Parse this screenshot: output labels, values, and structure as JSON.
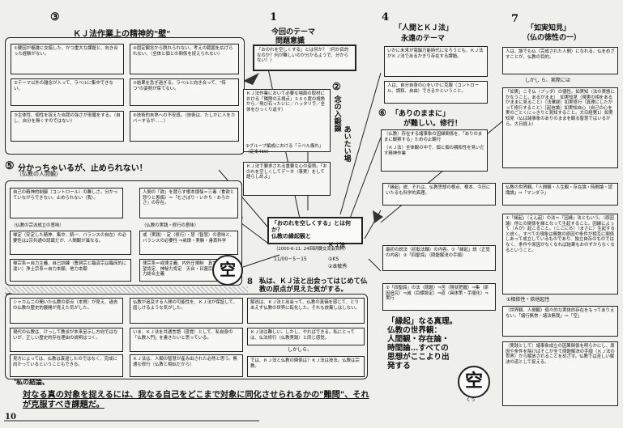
{
  "s3": {
    "num": "③",
    "title": "ＫＪ法作業上の精神的\"壁\"",
    "items": [
      "①要因が複雑に交錯した、かつ重大な課題と、向き合った経験がない。",
      "④固定観念から脱れられない。考えの範囲を広げられない。（全体と個との関係を捉えられない）",
      "②テーマ以外の雑念が入って、ラベルに集中できない。",
      "⑤結果を急ぎ過ぎる。ラベルと向き合って、\"待つ\"の姿勢が保てない。",
      "③主体性、個性を捉えた自我の強さが邪魔をする。（自し、自分を無くすのではない）",
      "⑥技術的未熟への不安感。（技術は、たしかに人をカバーするが……）"
    ]
  },
  "s5": {
    "num": "⑤",
    "title": "分かっちゃいるが、止められない！",
    "sub": "（仏教の人間観）",
    "left": "自己の精神的制御（コントロール）の難しさ。分かっていながらできない。止められない（我）。",
    "right": "人間の「欲」を競らす根本煩悩＝三毒（食欲と怒りと愚痴）＝「むさぼり・いかり・おろかさ」の存在。",
    "l_lbl": "（仏教の宗派成立の意味）",
    "r_lbl": "（仏教の実践・修行の意味）",
    "mid_l": "禅定（安定した精神、集中、統一、バランスの自在）の必要性は2宗共通の認識だが、人間観が異なる。",
    "mid_r": "戒（実践）・定（修行）・慧（智慧）の意味と、バランスの必要性 ⇒戒律・実験・書斎科学",
    "bot_l": "禅宗系＝自力主義、自己訓練（曹洞宗と臨済宗は臨床的に違い）浄土宗系＝自力本願、他力本願",
    "bot_r": "律宗系＝戒律主義、内外圧規制　真言宗系＝欲望肯定、神秘力肯定　天台・日蓮宗系＝自力他力総合主義"
  },
  "s1": {
    "num": "1",
    "title": "今回のテーマ",
    "sub": "問題意識",
    "q": "「おのれを空しくする」とは何か？（何か目的なのか？何が難しいのか分かるようで、分からない！）",
    "a": "ＫＪ法作業において必要な場面の取材における「隣際の五視点」３６０度の視角から／飛び石ったいに／ハッタリで／全体をひっくり返す）",
    "c": "②グループ編成における「ラベル振れ」（定本450）",
    "d": "ＫＪ法で要求される重要な心の姿勢。「おのれを空しくしてデータ（事実）をして語らしめよ」"
  },
  "s2": {
    "num": "②",
    "title": "念の入鍛錬",
    "sub": "あいたい場"
  },
  "s4": {
    "num": "4",
    "title": "「人間とＫＪ法」",
    "sub": "永遠のテーマ",
    "a": "いかに未来が電脳万能時代になろうとも、ＫＪ法がＫＪ法であるかぎり存在する課題。",
    "b": "人は、自分自身の心をいかに克服（コントロール、調和、自由）できるかということ。"
  },
  "s6": {
    "num": "⑥",
    "title": "「ありのままに」",
    "sub": "が難しい。修行！",
    "a": "（仏教）存在する諸事象の因縁関係を、「ありのままに観察する」ための止観行",
    "b": "（ＫＪ法）全体観の中で、個と個の親和性を見いだす精神作業"
  },
  "s7": {
    "num": "7",
    "title": "「如実知見」",
    "sub": "（仏の徳性の一）",
    "a": "人は、誰でも仏（完成された人間）になれる。仏をめざすことが、仏教の目的。",
    "but": "しかし ら、実際には",
    "b": "「如実」こそ仏（ブッダ）の徳性。如実知（法の実態にかなうこと。あるがまま）　如実知見（現実の相をあるがままに見ること）［法華経］如実修行（真理にしたがって修行すること）［起信論］如実知自心（自己の心を実のごとくにっきりと見知すること。大日経第1）如実知見（仏は諸事象のありのままを観る智慧ではいるから。大日経上）"
  },
  "center": {
    "title": "「おのれを空しくする」とは何か？",
    "sub": "仏教の縁起観と",
    "sub2": "ＫＪ法",
    "small": "（2000-6-11. 24回研鑽交流会資料）",
    "date": "11/00－5－15",
    "who": "②KS",
    "who2": "②本敏秀",
    "mark": "空"
  },
  "s8": {
    "num": "8",
    "text": "私は、ＫＪ法と出会ってはじめて仏教の原点が見えた気がする。"
  },
  "s9": {
    "num": "⑨",
    "a": "シャカムニの開いた仏教の原点（本質）が見え、過去の仏教の歴史的展開が見えた気がした。",
    "b": "仏教が追及する人間の可能性を、ＫＪ法が保証して、屈しけるような気がした。",
    "c": "解说は、ＫＪ法と出会って、仏教の真価を感じて、とりあえず仏教の世界に転化した。それも放棄しはしない。",
    "d": "現代の仏教は、けっして教派が本来呈示し方向ではないが、正しい歴史的存在理由の説明はつく。",
    "e": "いま、ＫＪ法を共通言語（感覚）として、私自身の「仏教入門」を書きたいと思っている。",
    "f": "ＫＪ法は難しい。しかし、やればできる。私にとっては、仏法修行（仏教実践）と同じ感覚。",
    "g": "見方によっては、仏教は衰退したのではなく、完成に向かっているということもできる。",
    "h": "ＫＪ法は、人類の智慧が産み出された必然と思う。無通な修行（仏教と相似だから）",
    "i": "ＫＪ法は、仏教と相似。すすめの場をもちたい。ＫＪ法は、仏教の。それこそ",
    "j": "では、ＫＪ法と仏教の関係は？ＫＪ法は技法。仏教は宗教。",
    "but": "しかしら、"
  },
  "right": {
    "a": "「縁起」説、それは、仏教思想の根点、根本、今日にいたるも科学的真理。",
    "b": "仏教の世界観。「人間観・人生観・存在論・時間論・認識論」⇒「マンダラ」",
    "c": "最初の説法（初転法輪）の内容。①「縁起」説（正覚の内容）②「四聖諦」（問題解決の手順）",
    "d": "①「縁起」（えん起）の法＝「因縁」法ともいう。（原因論）他との関係を縁となって生起すること。因縁によって（Ａが）起こること。（ここにＢ）（まさに）生起すると説く。すべての現象は無数の原因や条件が相互に関係しあって成立しているものであり、独立自存のものではなく、条件や原因がなくなれば結果もおのずからなくなるということ。",
    "e": "②「四聖諦」の法〈問題〉⇒苦（現状把握）⇒集（原因追究）⇒滅（目標設定）⇒道（具体策・手順化）⇒実行",
    "f": "①相依性・依他起性",
    "g": "（世界観、人間観）個々的な実体的存在をもってありえない。「諸行無常・諸法無我」＝「空」",
    "h": "〔実践として〕諸事象成立の因果関係を明らかにし、原因や条件を除けばそこが全て問題解決の手順（ＫＪ法の世界）から解放されることをめざす。仏教では苦しい解決の道として捉える。",
    "big": "「縁起」なる真理。\n仏教の世界観：\n人間観・存在論・\n時間論…すべての\n思想がここより出\n発する",
    "kuu": "空",
    "ku": "くう"
  },
  "s10": {
    "num": "10",
    "title": "〝私の結論〟",
    "text": "対なる真の対象を捉えるには、我なる自己をどこまで対象に同化させられるかの\"難問\"、それが克服すべき課題だ。"
  }
}
